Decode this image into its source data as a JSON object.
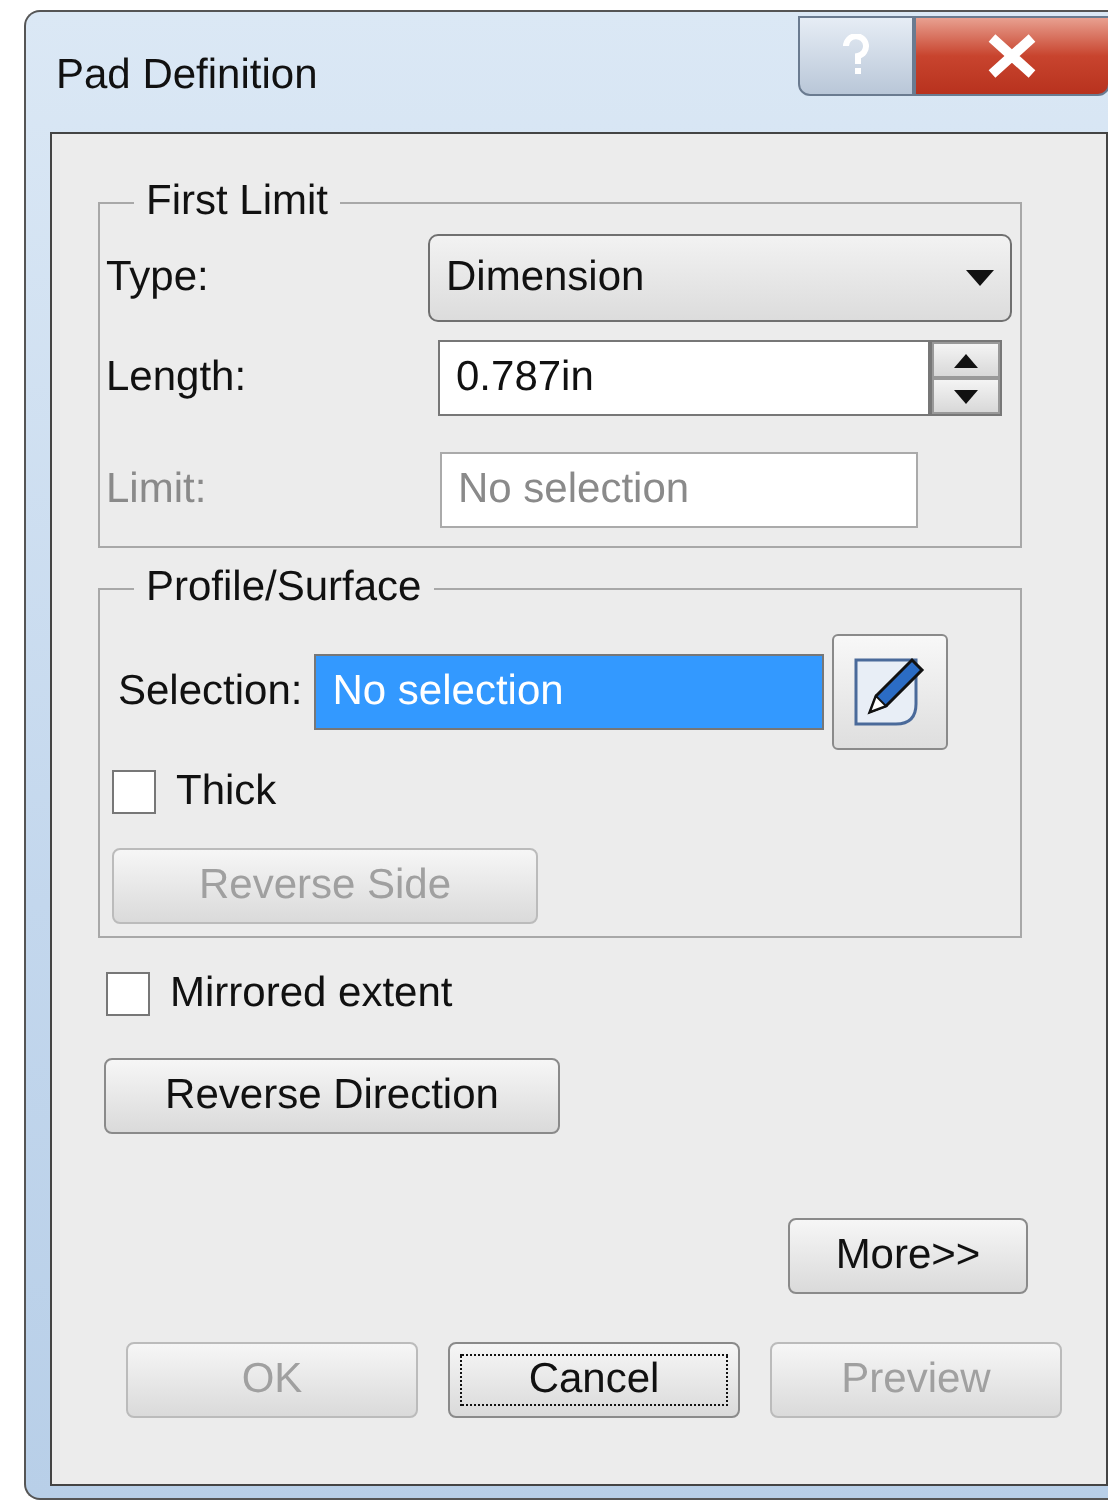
{
  "window": {
    "title": "Pad Definition"
  },
  "first_limit": {
    "title": "First Limit",
    "type": {
      "label": "Type:",
      "value": "Dimension"
    },
    "length": {
      "label": "Length:",
      "value": "0.787in"
    },
    "limit": {
      "label": "Limit:",
      "value": "No selection",
      "disabled": true
    }
  },
  "profile_surface": {
    "title": "Profile/Surface",
    "selection": {
      "label": "Selection:",
      "value": "No selection",
      "selected": true
    },
    "thick": {
      "label": "Thick",
      "checked": false
    },
    "reverse_side": {
      "label": "Reverse Side",
      "disabled": true
    }
  },
  "mirrored_extent": {
    "label": "Mirrored extent",
    "checked": false
  },
  "reverse_direction": {
    "label": "Reverse Direction",
    "disabled": false
  },
  "more_button": {
    "label": "More>>",
    "disabled": false
  },
  "buttons": [
    {
      "label": "OK",
      "disabled": true,
      "focused": false
    },
    {
      "label": "Cancel",
      "disabled": false,
      "focused": true
    },
    {
      "label": "Preview",
      "disabled": true,
      "focused": false
    }
  ]
}
